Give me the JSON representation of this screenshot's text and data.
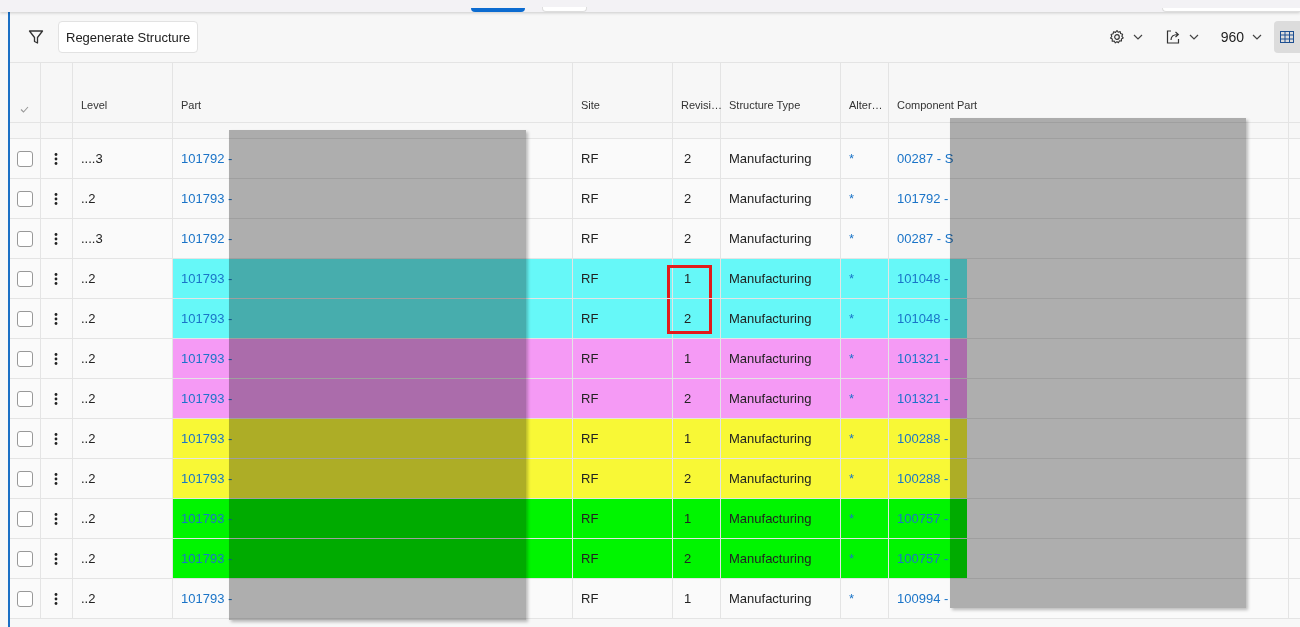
{
  "toolbar": {
    "action_button": "Regenerate Structure",
    "page_size": "960"
  },
  "table": {
    "columns": [
      "Level",
      "Part",
      "Site",
      "Revisi…",
      "Structure Type",
      "Alter…",
      "Component Part"
    ],
    "rows": [
      {
        "level": "....3",
        "part": "101792 -",
        "site": "RF",
        "revision": "2",
        "structure_type": "Manufacturing",
        "alternative": "*",
        "component_part": "00287 - S",
        "marked": false,
        "checked": false
      },
      {
        "level": "..2",
        "part": "101793 -",
        "site": "RF",
        "revision": "2",
        "structure_type": "Manufacturing",
        "alternative": "*",
        "component_part": "101792 -",
        "marked": false,
        "checked": false
      },
      {
        "level": "....3",
        "part": "101792 -",
        "site": "RF",
        "revision": "2",
        "structure_type": "Manufacturing",
        "alternative": "*",
        "component_part": "00287 - S",
        "marked": false,
        "checked": false
      },
      {
        "level": "..2",
        "part": "101793 -",
        "site": "RF",
        "revision": "1",
        "structure_type": "Manufacturing",
        "alternative": "*",
        "component_part": "101048 -",
        "color": "#66f8f8",
        "marked": true,
        "checked": false
      },
      {
        "level": "..2",
        "part": "101793 -",
        "site": "RF",
        "revision": "2",
        "structure_type": "Manufacturing",
        "alternative": "*",
        "component_part": "101048 -",
        "color": "#66f8f8",
        "marked": true,
        "checked": false
      },
      {
        "level": "..2",
        "part": "101793 -",
        "site": "RF",
        "revision": "1",
        "structure_type": "Manufacturing",
        "alternative": "*",
        "component_part": "101321 -",
        "color": "#f59af5",
        "marked": false,
        "checked": false
      },
      {
        "level": "..2",
        "part": "101793 -",
        "site": "RF",
        "revision": "2",
        "structure_type": "Manufacturing",
        "alternative": "*",
        "component_part": "101321 -",
        "color": "#f59af5",
        "marked": false,
        "checked": false
      },
      {
        "level": "..2",
        "part": "101793 -",
        "site": "RF",
        "revision": "1",
        "structure_type": "Manufacturing",
        "alternative": "*",
        "component_part": "100288 -",
        "color": "#f8f836",
        "marked": false,
        "checked": false
      },
      {
        "level": "..2",
        "part": "101793 -",
        "site": "RF",
        "revision": "2",
        "structure_type": "Manufacturing",
        "alternative": "*",
        "component_part": "100288 -",
        "color": "#f8f836",
        "marked": false,
        "checked": false
      },
      {
        "level": "..2",
        "part": "101793 -",
        "site": "RF",
        "revision": "1",
        "structure_type": "Manufacturing",
        "alternative": "*",
        "component_part": "100757 -",
        "color": "#00f500",
        "marked": false,
        "checked": false
      },
      {
        "level": "..2",
        "part": "101793 -",
        "site": "RF",
        "revision": "2",
        "structure_type": "Manufacturing",
        "alternative": "*",
        "component_part": "100757 -",
        "color": "#00f500",
        "marked": false,
        "checked": false
      },
      {
        "level": "..2",
        "part": "101793 -",
        "site": "RF",
        "revision": "1",
        "structure_type": "Manufacturing",
        "alternative": "*",
        "component_part": "100994 -",
        "marked": false,
        "checked": false
      }
    ]
  }
}
